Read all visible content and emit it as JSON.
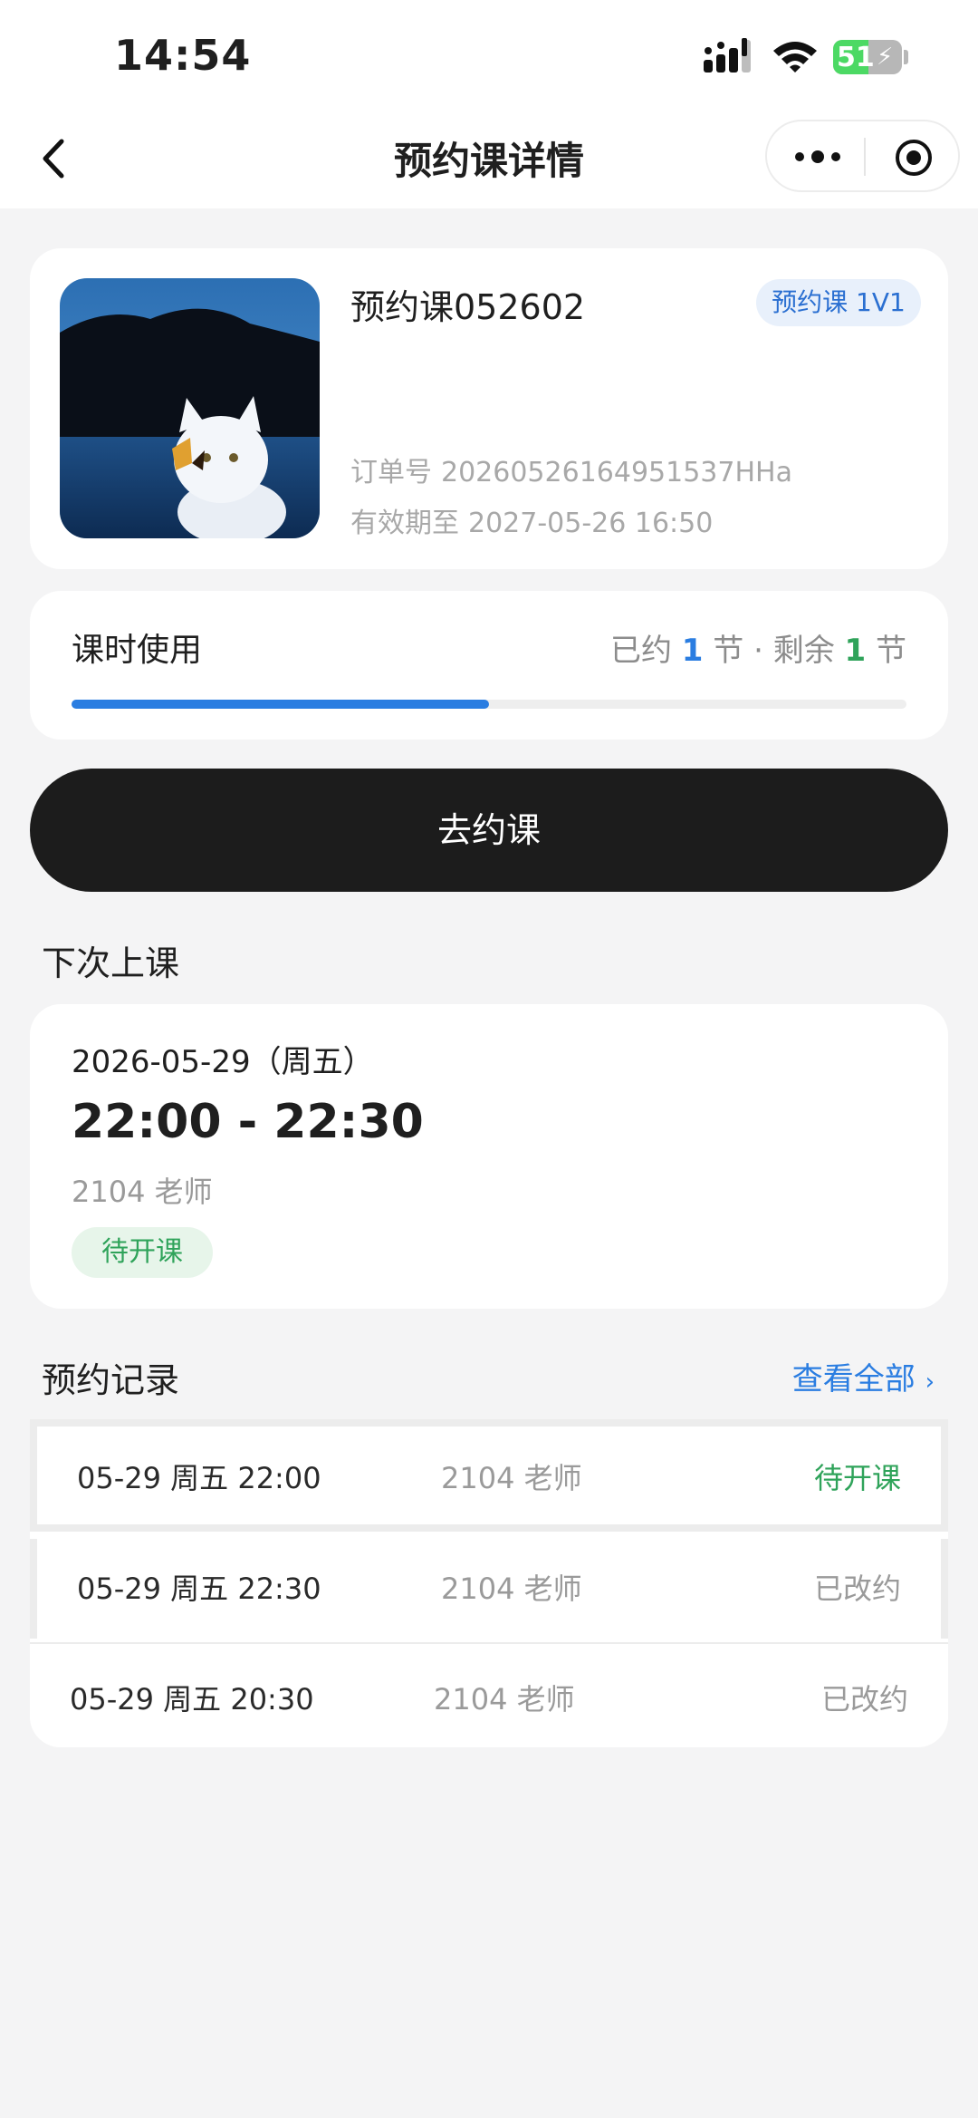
{
  "status_bar": {
    "time": "14:54",
    "battery": "51",
    "battery_level": 0.51
  },
  "nav": {
    "title": "预约课详情"
  },
  "course": {
    "name": "预约课052602",
    "badge": "预约课 1V1",
    "order_label": "订单号",
    "order_no": "20260526164951537HHa",
    "expiry_label": "有效期至",
    "expiry": "2027-05-26 16:50"
  },
  "usage": {
    "title": "课时使用",
    "booked_prefix": "已约",
    "booked": "1",
    "unit": "节",
    "separator": "·",
    "remaining_prefix": "剩余",
    "remaining": "1",
    "progress": 0.5
  },
  "primary_button": "去约课",
  "next_class": {
    "section_title": "下次上课",
    "date": "2026-05-29（周五）",
    "time": "22:00 - 22:30",
    "teacher": "2104 老师",
    "status": "待开课"
  },
  "records": {
    "section_title": "预约记录",
    "view_all": "查看全部",
    "items": [
      {
        "time": "05-29 周五 22:00",
        "teacher": "2104 老师",
        "status": "待开课"
      },
      {
        "time": "05-29 周五 22:30",
        "teacher": "2104 老师",
        "status": "已改约"
      },
      {
        "time": "05-29 周五 20:30",
        "teacher": "2104 老师",
        "status": "已改约"
      }
    ]
  },
  "colors": {
    "accent_blue": "#2a7de1",
    "accent_green": "#2fa35a",
    "button_dark": "#1c1c1c"
  }
}
